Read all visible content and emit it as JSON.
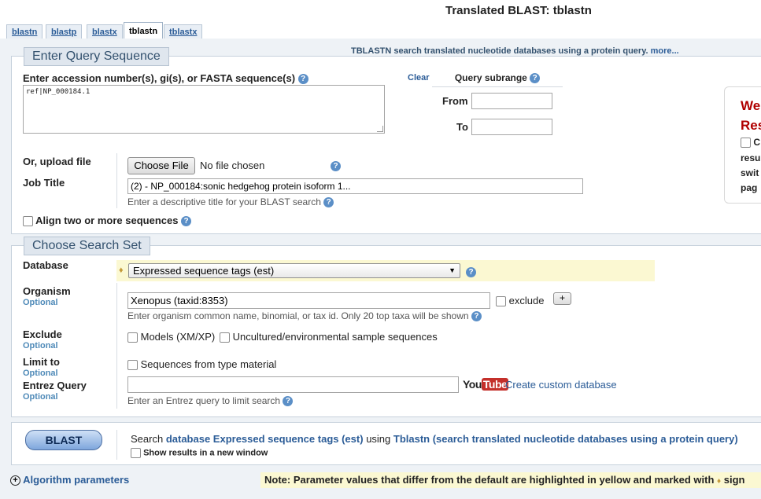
{
  "page": {
    "title": "Translated BLAST: tblastn",
    "tabs": [
      "blastn",
      "blastp",
      "blastx",
      "tblastn",
      "tblastx"
    ],
    "active_tab": "tblastn"
  },
  "query": {
    "legend": "Enter Query Sequence",
    "description": "TBLASTN search translated nucleotide databases using a protein query.",
    "more_link": "more...",
    "input_label": "Enter accession number(s), gi(s), or FASTA sequence(s)",
    "clear_link": "Clear",
    "query_value": "ref|NP_000184.1",
    "subrange_title": "Query subrange",
    "from_label": "From",
    "to_label": "To",
    "upload_label": "Or, upload file",
    "choose_file_button": "Choose File",
    "no_file_text": "No file chosen",
    "job_title_label": "Job Title",
    "job_title_value": "(2) - NP_000184:sonic hedgehog protein isoform 1...",
    "job_title_hint": "Enter a descriptive title for your BLAST search",
    "align_two_label": "Align two or more sequences"
  },
  "side_box": {
    "line1": "We",
    "line2": "Res",
    "line3": "C",
    "line4": "resu",
    "line5": "swit",
    "line6": "pag"
  },
  "search_set": {
    "legend": "Choose Search Set",
    "database_label": "Database",
    "database_value": "Expressed sequence tags (est)",
    "organism_label": "Organism",
    "optional": "Optional",
    "organism_value": "Xenopus (taxid:8353)",
    "exclude_label": "exclude",
    "add_button": "+",
    "organism_hint": "Enter organism common name, binomial, or tax id. Only 20 top taxa will be shown",
    "exclude_section_label": "Exclude",
    "models_label": "Models (XM/XP)",
    "uncultured_label": "Uncultured/environmental sample sequences",
    "limit_label": "Limit to",
    "type_material_label": "Sequences from type material",
    "entrez_label": "Entrez Query",
    "youtube_you": "You",
    "youtube_tube": "Tube",
    "custom_db_link": "Create custom database",
    "entrez_hint": "Enter an Entrez query to limit search"
  },
  "submit": {
    "blast_button": "BLAST",
    "search_prefix": "Search",
    "search_db": "database Expressed sequence tags (est)",
    "using": "using",
    "program": "Tblastn (search translated nucleotide databases using a protein query)",
    "new_window_label": "Show results in a new window"
  },
  "footer": {
    "algorithm_link": "Algorithm parameters",
    "note": "Note: Parameter values that differ from the default are highlighted in yellow and marked with",
    "note_tail": "sign"
  }
}
